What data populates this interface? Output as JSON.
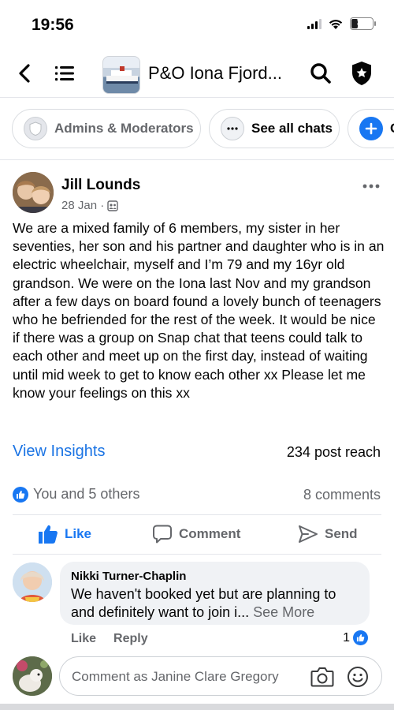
{
  "status_bar": {
    "time": "19:56",
    "battery_level": "34",
    "battery_fraction": 0.34
  },
  "header": {
    "group_title": "P&O Iona Fjord...",
    "icons": [
      "back-icon",
      "menu-icon",
      "search-icon",
      "shield-icon"
    ]
  },
  "chips": [
    {
      "label": "Admins & Moderators",
      "icon": "shield-badge-icon"
    },
    {
      "label": "See all chats",
      "icon": "ellipsis-icon"
    },
    {
      "label": "Cr",
      "icon": "plus-icon"
    }
  ],
  "post": {
    "author": "Jill Lounds",
    "date": "28 Jan ·",
    "audience_icon": "group-icon",
    "body": "We are a mixed family of 6 members, my sister in her seventies, her son and his partner and daughter who is in an electric wheelchair, myself and I’m 79 and my 16yr old grandson. We were on the Iona last Nov and my grandson after a few days on board found a lovely bunch of teenagers who he befriended for the rest of the week. It would be nice if there was a group on Snap chat that teens could talk to each other and meet up on the first day, instead of waiting until mid week to get to know each other xx Please let me know your feelings on this xx",
    "insights_label": "View Insights",
    "reach_label": "234 post reach",
    "reactions_label": "You and 5 others",
    "comments_label": "8 comments",
    "actions": {
      "like": "Like",
      "comment": "Comment",
      "send": "Send"
    }
  },
  "comment": {
    "author": "Nikki Turner-Chaplin",
    "text": "We haven't booked yet but are planning to and definitely want to join i...",
    "see_more": "See More",
    "like_label": "Like",
    "reply_label": "Reply",
    "like_count": "1"
  },
  "composer": {
    "placeholder": "Comment as Janine Clare Gregory"
  },
  "colors": {
    "accent": "#1877f2",
    "link": "#1b74e4",
    "secondary_text": "#65676b",
    "bubble": "#f0f2f5"
  }
}
